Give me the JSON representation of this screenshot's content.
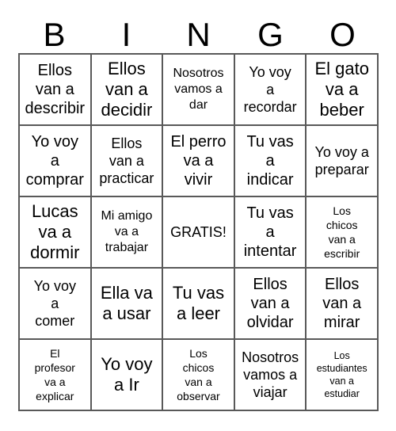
{
  "card": {
    "title_letters": [
      "B",
      "I",
      "N",
      "G",
      "O"
    ],
    "free_space_label": "GRATIS!",
    "colors": {
      "background": "#ffffff",
      "text": "#000000",
      "grid_line": "#595959"
    },
    "rows": [
      [
        {
          "text": "Ellos\nvan a\ndescribir",
          "size": "fs-lg"
        },
        {
          "text": "Ellos\nvan a\ndecidir",
          "size": "fs-xl"
        },
        {
          "text": "Nosotros\nvamos a\ndar",
          "size": "fs-sm"
        },
        {
          "text": "Yo voy\na\nrecordar",
          "size": "fs-md"
        },
        {
          "text": "El gato\nva a\nbeber",
          "size": "fs-xl"
        }
      ],
      [
        {
          "text": "Yo voy\na\ncomprar",
          "size": "fs-lg"
        },
        {
          "text": "Ellos\nvan a\npracticar",
          "size": "fs-md"
        },
        {
          "text": "El perro\nva a\nvivir",
          "size": "fs-lg"
        },
        {
          "text": "Tu vas\na\nindicar",
          "size": "fs-lg"
        },
        {
          "text": "Yo voy a\npreparar",
          "size": "fs-md"
        }
      ],
      [
        {
          "text": "Lucas\nva a\ndormir",
          "size": "fs-xl"
        },
        {
          "text": "Mi amigo\nva a\ntrabajar",
          "size": "fs-sm"
        },
        {
          "text": "GRATIS!",
          "size": "fs-md"
        },
        {
          "text": "Tu vas\na\nintentar",
          "size": "fs-lg"
        },
        {
          "text": "Los\nchicos\nvan a\nescribir",
          "size": "fs-xs"
        }
      ],
      [
        {
          "text": "Yo voy\na\ncomer",
          "size": "fs-md"
        },
        {
          "text": "Ella va\na usar",
          "size": "fs-xl"
        },
        {
          "text": "Tu vas\na leer",
          "size": "fs-xl"
        },
        {
          "text": "Ellos\nvan a\nolvidar",
          "size": "fs-lg"
        },
        {
          "text": "Ellos\nvan a\nmirar",
          "size": "fs-lg"
        }
      ],
      [
        {
          "text": "El\nprofesor\nva a\nexplicar",
          "size": "fs-xs"
        },
        {
          "text": "Yo voy\na Ir",
          "size": "fs-xl"
        },
        {
          "text": "Los\nchicos\nvan a\nobservar",
          "size": "fs-xs"
        },
        {
          "text": "Nosotros\nvamos a\nviajar",
          "size": "fs-md"
        },
        {
          "text": "Los\nestudiantes\nvan a\nestudiar",
          "size": "fs-xxs"
        }
      ]
    ]
  }
}
